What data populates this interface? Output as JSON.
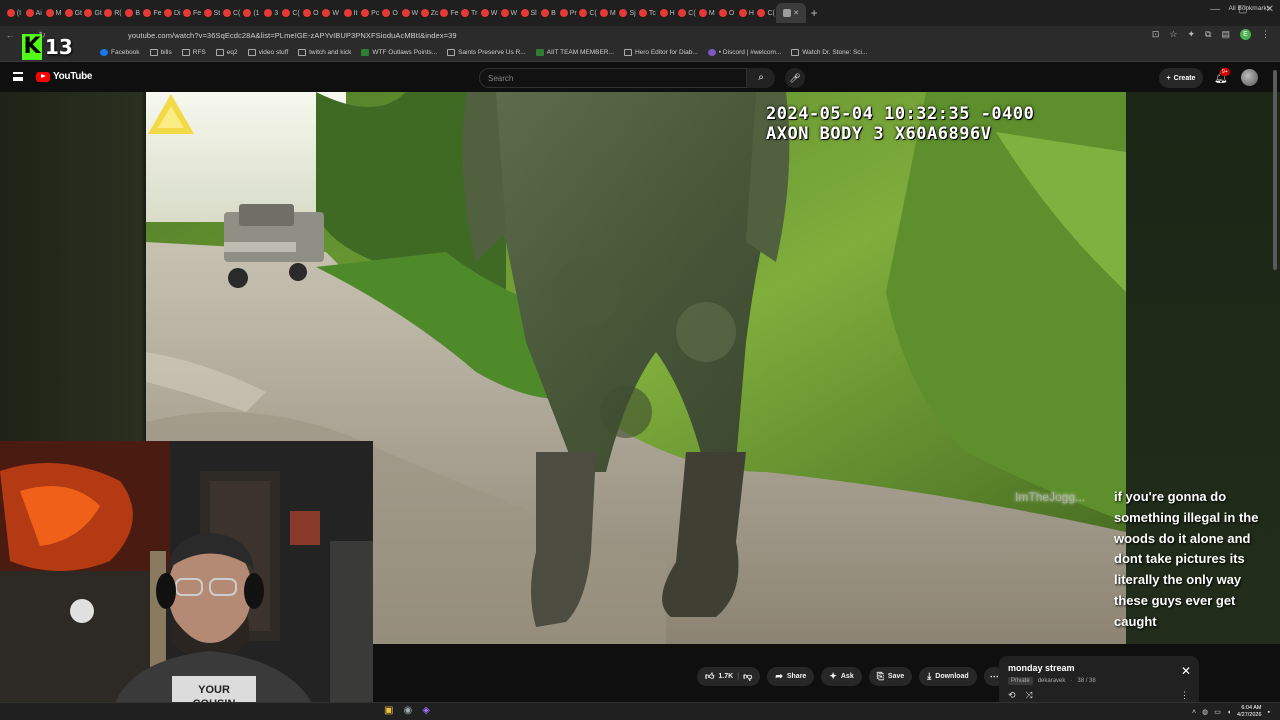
{
  "browser": {
    "url": "youtube.com/watch?v=36SqEcdc28A&list=PLmeIGE-zAPYvIBUP3PNXFSioduAcMBtI&index=39",
    "tabs": [
      {
        "label": "(I"
      },
      {
        "label": "Ai"
      },
      {
        "label": "M"
      },
      {
        "label": "Gt"
      },
      {
        "label": "Gt"
      },
      {
        "label": "R("
      },
      {
        "label": "B"
      },
      {
        "label": "Fe"
      },
      {
        "label": "Di"
      },
      {
        "label": "Fe"
      },
      {
        "label": "St"
      },
      {
        "label": "C("
      },
      {
        "label": "(1"
      },
      {
        "label": "3"
      },
      {
        "label": "C("
      },
      {
        "label": "O"
      },
      {
        "label": "W"
      },
      {
        "label": "It"
      },
      {
        "label": "Pc"
      },
      {
        "label": "O"
      },
      {
        "label": "W"
      },
      {
        "label": "Zc"
      },
      {
        "label": "Fe"
      },
      {
        "label": "Tr"
      },
      {
        "label": "W"
      },
      {
        "label": "W"
      },
      {
        "label": "Sl"
      },
      {
        "label": "B"
      },
      {
        "label": "Pr"
      },
      {
        "label": "C("
      },
      {
        "label": "M"
      },
      {
        "label": "Sj"
      },
      {
        "label": "Tc"
      },
      {
        "label": "H"
      },
      {
        "label": "C("
      },
      {
        "label": "M"
      },
      {
        "label": "O"
      },
      {
        "label": "H"
      },
      {
        "label": "C("
      }
    ],
    "bookmarks": [
      {
        "label": "Facebook",
        "icon": "facebook-icon"
      },
      {
        "label": "bills",
        "icon": "folder-icon"
      },
      {
        "label": "RFS",
        "icon": "folder-icon"
      },
      {
        "label": "eq2",
        "icon": "folder-icon"
      },
      {
        "label": "video stuff",
        "icon": "folder-icon"
      },
      {
        "label": "twitch and kick",
        "icon": "folder-icon"
      },
      {
        "label": "WTF Outlaws Points...",
        "icon": "green-square-icon"
      },
      {
        "label": "Saints Preserve Us R...",
        "icon": "pin-icon"
      },
      {
        "label": "AIIT TEAM MEMBER...",
        "icon": "green-square-icon"
      },
      {
        "label": "Hero Editor for Diab...",
        "icon": "page-icon"
      },
      {
        "label": "• Discord | #welcom...",
        "icon": "discord-icon"
      },
      {
        "label": "Watch Dr. Stone: Sci...",
        "icon": "page-icon"
      }
    ],
    "all_bookmarks": "All Bookmarks",
    "profile_initial": "E"
  },
  "kick_overlay": {
    "logo": "K",
    "number": "13"
  },
  "youtube": {
    "logo_text": "YouTube",
    "search_placeholder": "Search",
    "create_label": "Create",
    "notification_badge": "9+"
  },
  "video": {
    "timestamp": "2024-05-04 10:32:35 -0400",
    "device": "AXON BODY 3 X60A6896V"
  },
  "chat": {
    "username": "ImTheJogg...",
    "message": "if you're gonna do something illegal in the woods do it alone and dont take pictures its literally the only way these guys ever get caught"
  },
  "actions": {
    "like_count": "1.7K",
    "share": "Share",
    "ask": "Ask",
    "save": "Save",
    "download": "Download"
  },
  "playlist": {
    "title": "monday stream",
    "privacy": "Private",
    "owner": "dekaravek",
    "position": "38 / 38"
  },
  "taskbar": {
    "time": "6:04 AM",
    "date": "4/27/2026"
  },
  "colors": {
    "youtube_red": "#ff0000",
    "kick_green": "#53fc18",
    "background": "#0f0f0f"
  }
}
